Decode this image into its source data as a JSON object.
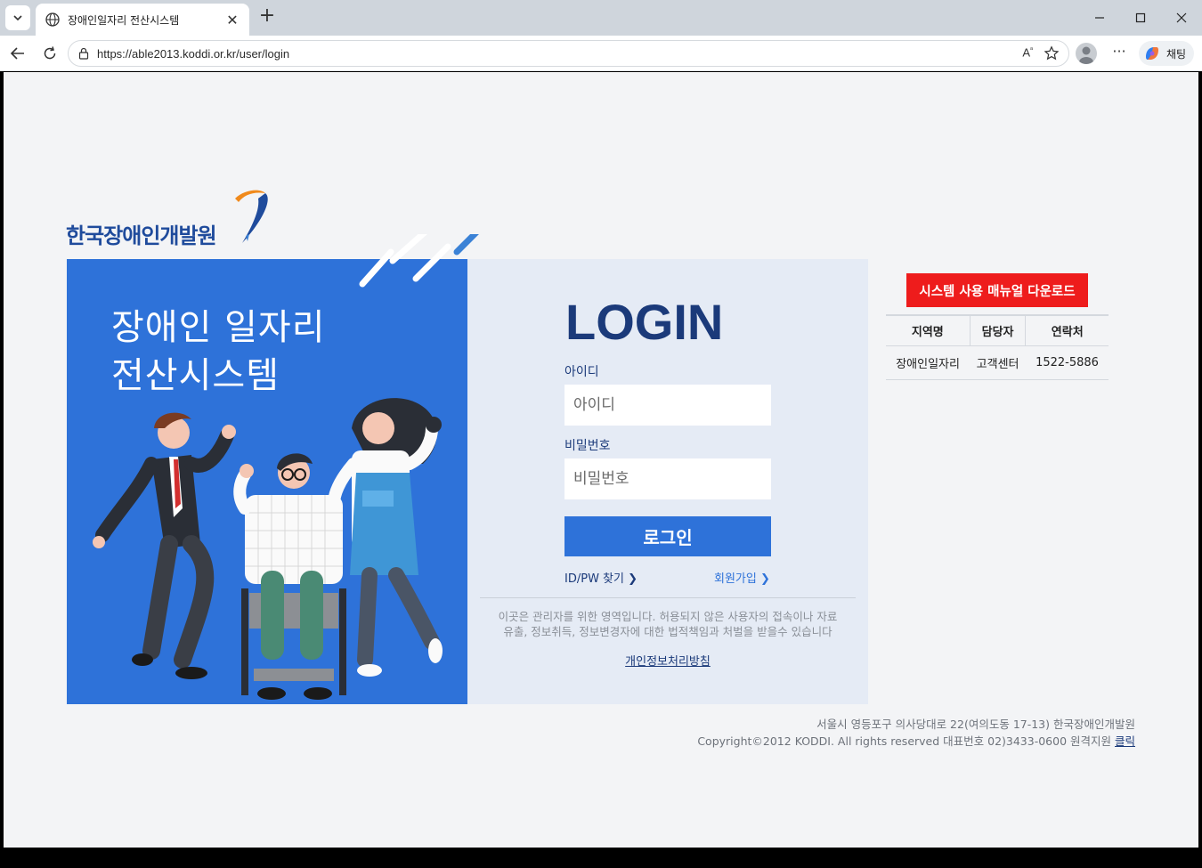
{
  "browser": {
    "tab_title": "장애인일자리 전산시스템",
    "url": "https://able2013.koddi.or.kr/user/login",
    "chat_label": "채팅"
  },
  "logo": {
    "org_name": "한국장애인개발원"
  },
  "hero": {
    "line1": "장애인 일자리",
    "line2": "전산시스템"
  },
  "login": {
    "title": "LOGIN",
    "id_label": "아이디",
    "id_placeholder": "아이디",
    "pw_label": "비밀번호",
    "pw_placeholder": "비밀번호",
    "submit_label": "로그인",
    "find_link": "ID/PW 찾기 ❯",
    "join_link": "회원가입 ❯",
    "warning_line1": "이곳은 관리자를 위한 영역입니다. 허용되지 않은 사용자의 접속이나 자료",
    "warning_line2": "유출, 정보취득, 정보변경자에 대한 법적책임과 처벌을 받을수 있습니다",
    "privacy_link": "개인정보처리방침"
  },
  "contact": {
    "manual_button": "시스템 사용 매뉴얼 다운로드",
    "headers": [
      "지역명",
      "담당자",
      "연락처"
    ],
    "rows": [
      [
        "장애인일자리",
        "고객센터",
        "1522-5886"
      ]
    ]
  },
  "footer": {
    "address": "서울시 영등포구 의사당대로 22(여의도동 17-13) 한국장애인개발원",
    "copyright": "Copyright©2012 KODDI. All rights reserved 대표번호 02)3433-0600 원격지원 ",
    "remote_link": "클릭"
  },
  "colors": {
    "primary_blue": "#2e72d9",
    "navy": "#1b3a7a",
    "manual_red": "#ee1c1c",
    "panel_light": "#e5ebf5",
    "logo_orange": "#f08a1c"
  }
}
